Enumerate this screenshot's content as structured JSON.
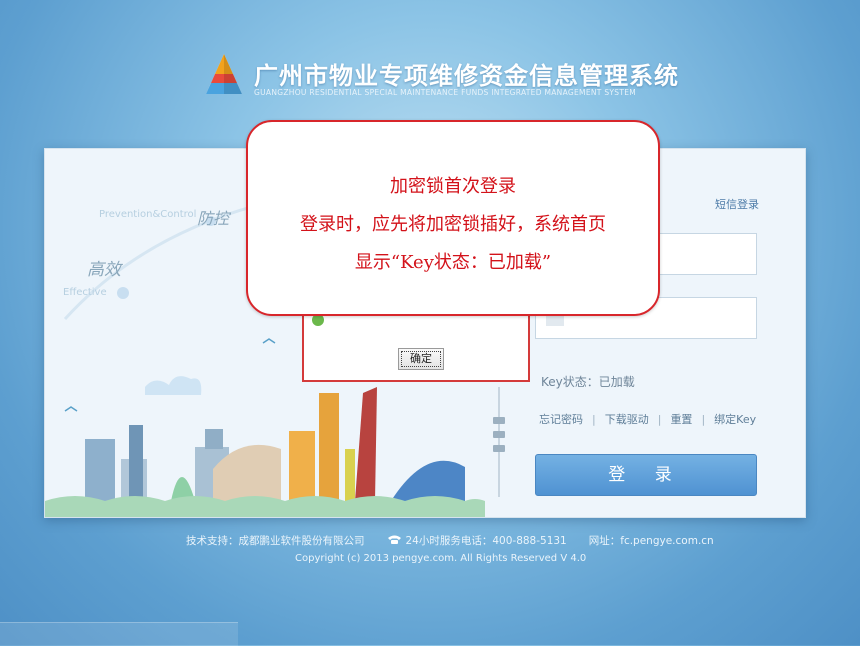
{
  "header": {
    "title": "广州市物业专项维修资金信息管理系统",
    "subtitle": "GUANGZHOU RESIDENTIAL SPECIAL MAINTENANCE FUNDS INTEGRATED MANAGEMENT SYSTEM",
    "logo_icon": "pyramid-logo-icon"
  },
  "illustration": {
    "word_control": "防控",
    "word_control_en": "Prevention&Control",
    "word_efficient": "高效",
    "word_efficient_en": "Effective"
  },
  "login": {
    "sms_login_label": "短信登录",
    "username_value": "",
    "password_value": "",
    "key_status": "Key状态：已加载",
    "links": [
      "忘记密码",
      "下载驱动",
      "重置",
      "绑定Key"
    ],
    "login_button": "登 录"
  },
  "dialog": {
    "ok_button": "确定"
  },
  "callout": {
    "line1": "加密锁首次登录",
    "line2": "登录时，应先将加密锁插好，系统首页",
    "line3": "显示“Key状态：已加载”"
  },
  "footer": {
    "support": "技术支持：成都鹏业软件股份有限公司",
    "hotline": "24小时服务电话：400-888-5131",
    "website": "网址：fc.pengye.com.cn",
    "copyright": "Copyright (c) 2013 pengye.com. All Rights Reserved V 4.0"
  },
  "colors": {
    "background": "#6aa9d6",
    "login_button": "#5b9ad6",
    "callout_border": "#d8262b",
    "callout_text": "#d3121a"
  }
}
